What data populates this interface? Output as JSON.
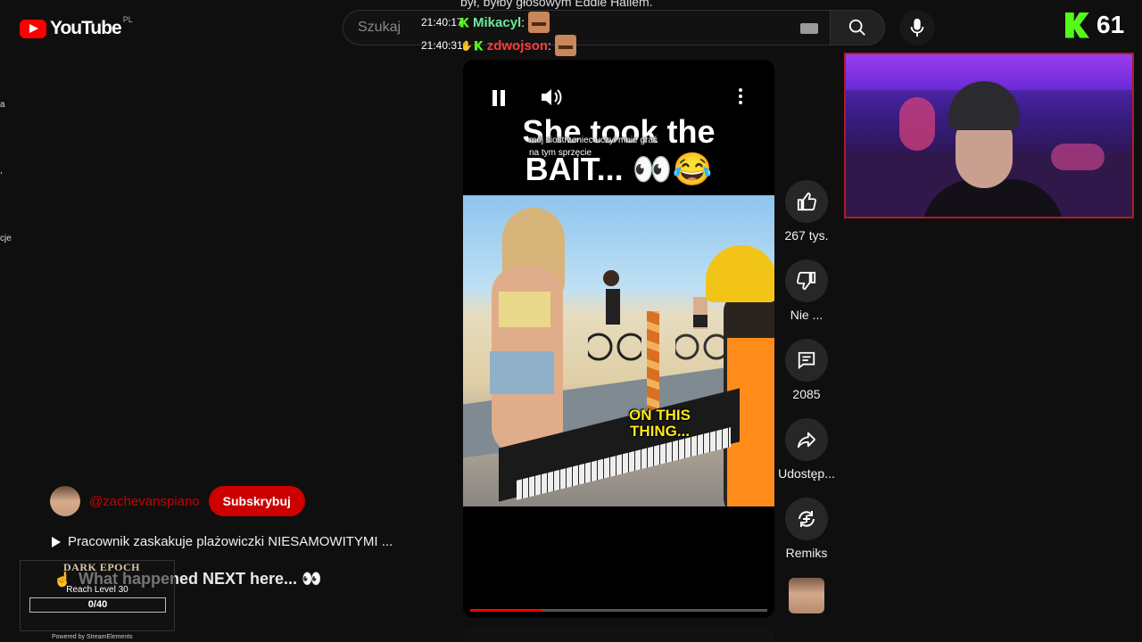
{
  "youtube": {
    "logo_text": "YouTube",
    "region": "PL",
    "search_placeholder": "Szukaj"
  },
  "overlay_top_text": "był, byłby głosowym Eddie Hallem.",
  "chat": [
    {
      "time": "21:40:17",
      "user": "Mikacyl",
      "color": "#6ee99a"
    },
    {
      "time": "21:40:31",
      "user": "zdwojson",
      "color": "#ff3b3b"
    }
  ],
  "kick": {
    "viewer_count": "61"
  },
  "short": {
    "title_line1": "She took the",
    "title_line2": "BAIT... 👀😂",
    "subtitle": "mój siostrzeniec uczył mnie grać\nna tym sprzęcie",
    "caption_line1": "ON THIS",
    "caption_line2": "THING...",
    "progress_fraction": 0.24
  },
  "actions": {
    "like_count": "267 tys.",
    "dislike_label": "Nie ...",
    "comments_count": "2085",
    "share_label": "Udostęp...",
    "remix_label": "Remiks"
  },
  "channel": {
    "handle": "@zachevanspiano",
    "subscribe_label": "Subskrybuj"
  },
  "video": {
    "title": "Pracownik zaskakuje plażowiczki NIESAMOWITYMI ...",
    "description": "What happened NEXT here... 👀"
  },
  "widget": {
    "game": "DARK EPOCH",
    "goal": "Reach Level 30",
    "progress": "0/40",
    "progress_fraction": 0,
    "powered_by": "Powered by StreamElements"
  },
  "side_fragments": [
    "a",
    ",",
    "cje"
  ]
}
